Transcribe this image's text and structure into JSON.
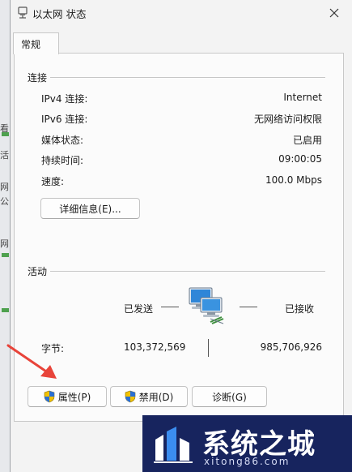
{
  "window": {
    "title": "以太网 状态",
    "close_icon": "close-icon"
  },
  "background_window": {
    "fragments": [
      "看",
      "活",
      "网",
      "公",
      "网"
    ]
  },
  "tabs": [
    {
      "label": "常规"
    }
  ],
  "connection": {
    "group_title": "连接",
    "rows": [
      {
        "label": "IPv4 连接:",
        "value": "Internet"
      },
      {
        "label": "IPv6 连接:",
        "value": "无网络访问权限"
      },
      {
        "label": "媒体状态:",
        "value": "已启用"
      },
      {
        "label": "持续时间:",
        "value": "09:00:05"
      },
      {
        "label": "速度:",
        "value": "100.0 Mbps"
      }
    ],
    "details_button": "详细信息(E)..."
  },
  "activity": {
    "group_title": "活动",
    "sent_label": "已发送",
    "received_label": "已接收",
    "bytes_label": "字节:",
    "bytes_sent": "103,372,569",
    "bytes_received": "985,706,926",
    "network_icon": "network-computers-icon"
  },
  "buttons": {
    "properties": "属性(P)",
    "disable": "禁用(D)",
    "diagnose": "诊断(G)",
    "shield_icon": "uac-shield-icon"
  },
  "annotation": {
    "arrow_color": "#e8443a"
  },
  "watermark": {
    "name": "系统之城",
    "url": "xitong86.com",
    "bg_color": "#17245e"
  }
}
